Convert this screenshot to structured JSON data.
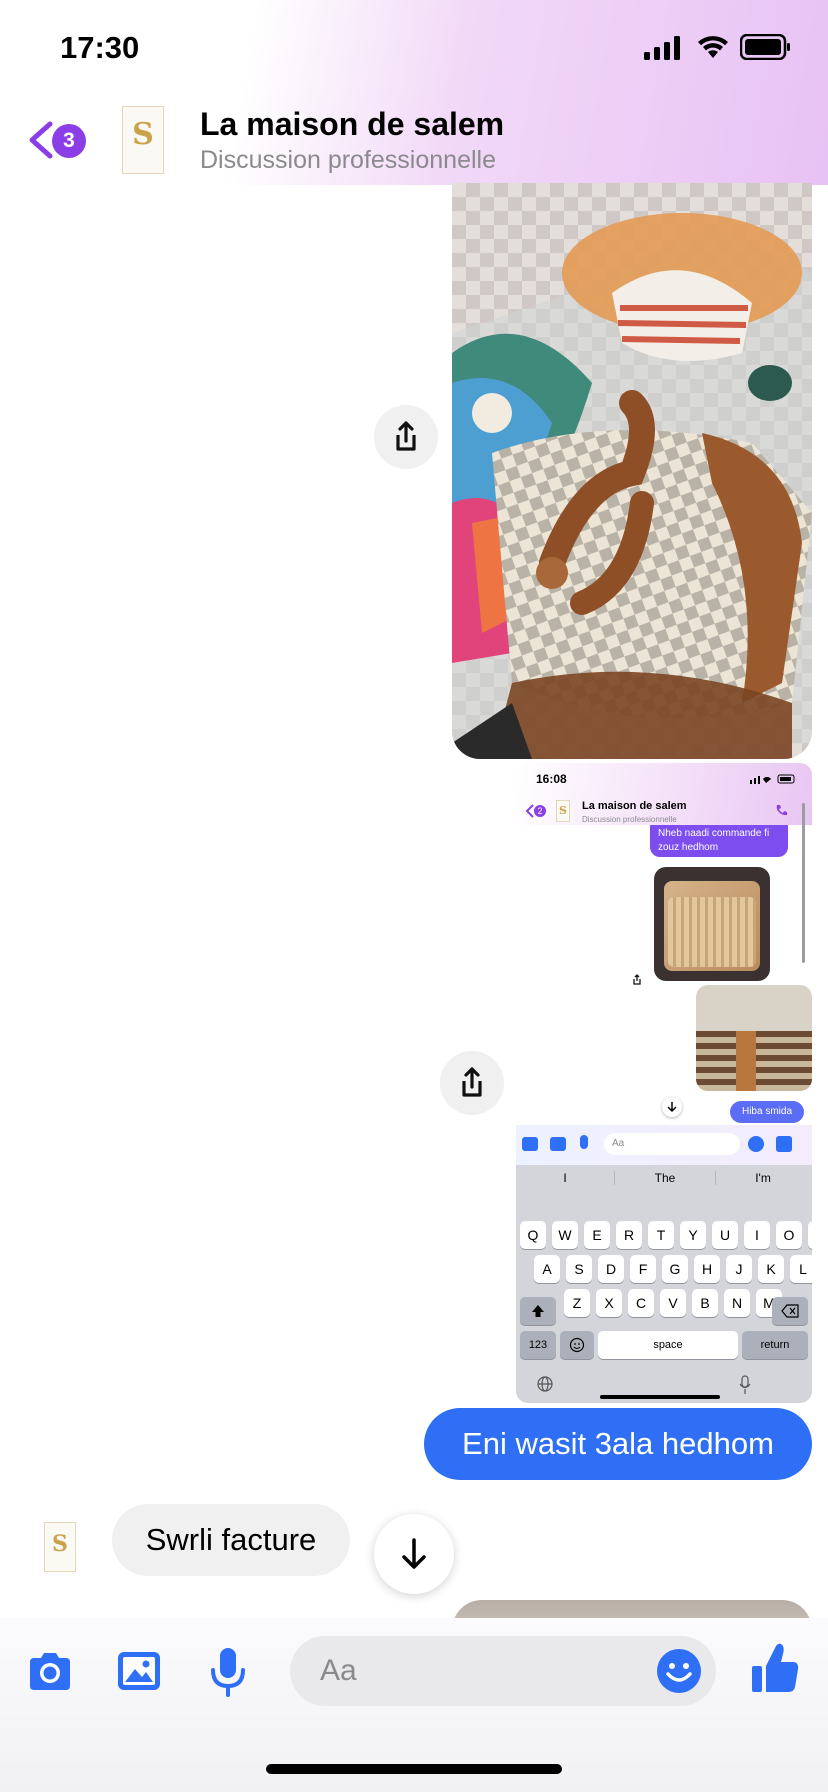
{
  "status_bar": {
    "time": "17:30"
  },
  "header": {
    "back_badge": "3",
    "contact_name": "La maison de salem",
    "subtitle": "Discussion professionnelle",
    "avatar_letter": "S"
  },
  "messages": {
    "outgoing_1": "Eni wasit 3ala hedhom",
    "incoming_1": "Swrli facture"
  },
  "composer": {
    "placeholder": "Aa"
  },
  "screenshot": {
    "time": "16:08",
    "back_badge": "2",
    "contact_name": "La maison de salem",
    "subtitle": "Discussion professionnelle",
    "message_1": "Nheb naadi commande fi zouz hedhom",
    "message_2": "Hiba smida",
    "input_placeholder": "Aa",
    "suggestions": [
      "I",
      "The",
      "I'm"
    ],
    "keyboard_row1": [
      "Q",
      "W",
      "E",
      "R",
      "T",
      "Y",
      "U",
      "I",
      "O",
      "P"
    ],
    "keyboard_row2": [
      "A",
      "S",
      "D",
      "F",
      "G",
      "H",
      "J",
      "K",
      "L"
    ],
    "keyboard_row3": [
      "Z",
      "X",
      "C",
      "V",
      "B",
      "N",
      "M"
    ],
    "key_123": "123",
    "key_space": "space",
    "key_return": "return"
  },
  "colors": {
    "accent": "#2f6ff5",
    "badge": "#8b3ee6",
    "messenger_blue": "#1877f2"
  }
}
